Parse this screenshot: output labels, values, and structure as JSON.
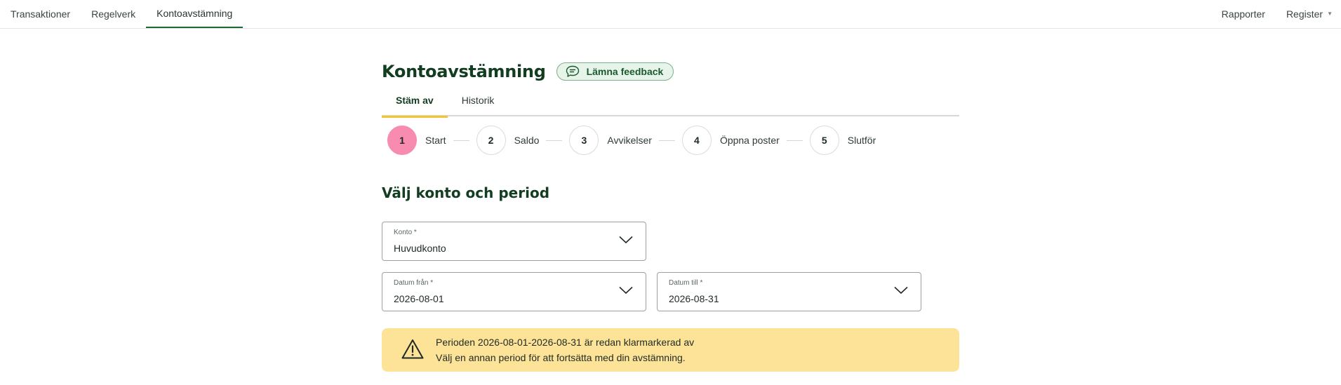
{
  "topnav": {
    "left": [
      {
        "label": "Transaktioner",
        "active": false
      },
      {
        "label": "Regelverk",
        "active": false
      },
      {
        "label": "Kontoavstämning",
        "active": true
      }
    ],
    "right": [
      {
        "label": "Rapporter"
      },
      {
        "label": "Register"
      }
    ]
  },
  "page": {
    "title": "Kontoavstämning",
    "feedback_label": "Lämna feedback"
  },
  "tabs": [
    {
      "label": "Stäm av",
      "active": true
    },
    {
      "label": "Historik",
      "active": false
    }
  ],
  "stepper": [
    {
      "number": "1",
      "label": "Start",
      "current": true
    },
    {
      "number": "2",
      "label": "Saldo",
      "current": false
    },
    {
      "number": "3",
      "label": "Avvikelser",
      "current": false
    },
    {
      "number": "4",
      "label": "Öppna poster",
      "current": false
    },
    {
      "number": "5",
      "label": "Slutför",
      "current": false
    }
  ],
  "section": {
    "title": "Välj konto och period"
  },
  "form": {
    "account": {
      "label": "Konto *",
      "value": "Huvudkonto"
    },
    "date_from": {
      "label": "Datum från *",
      "value": "2026-08-01"
    },
    "date_to": {
      "label": "Datum till *",
      "value": "2026-08-31"
    }
  },
  "alert": {
    "line1": "Perioden 2026-08-01-2026-08-31 är redan klarmarkerad av",
    "line2": "Välj en annan period för att fortsätta med din avstämning."
  },
  "icons": {
    "feedback": "chat-bubble-icon",
    "dropdown": "chevron-down-icon",
    "warning": "warning-triangle-icon"
  },
  "colors": {
    "brand_green": "#123d20",
    "nav_active_underline": "#1c6b2f",
    "tab_active_underline": "#f2c630",
    "step_current": "#f78bb0",
    "alert_bg": "#fde398",
    "feedback_bg": "#e7f4ea"
  }
}
